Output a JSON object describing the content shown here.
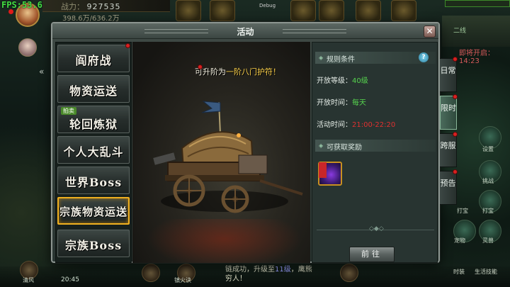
{
  "hud": {
    "fps": "FPS:53.69",
    "power_label": "战力：",
    "power_value": "927535",
    "gold": "398.6万/636.2万",
    "debug": "Debug",
    "minimap_label": "二线",
    "timer": "即将开启：14:23",
    "chat_line1_a": "链成功，升级至",
    "chat_line1_b": "11级",
    "chat_line1_c": "，鹰熊",
    "chat_line2": "穷人！",
    "bottom_time": "20:45",
    "bottom_label_a": "清风",
    "bottom_label_b": "镇火诀",
    "right_labels": [
      "设置",
      "挑战",
      "打宝",
      "打宝",
      "宠物",
      "灵兽",
      "时装",
      "生活技能"
    ]
  },
  "dialog": {
    "title": "活动",
    "close": "✕",
    "menu": [
      {
        "label": "阎府战",
        "tag": "",
        "active": false
      },
      {
        "label": "物资运送",
        "tag": "",
        "active": false
      },
      {
        "label": "轮回炼狱",
        "tag": "拍卖",
        "active": false
      },
      {
        "label": "个人大乱斗",
        "tag": "",
        "active": false
      },
      {
        "label": "世界Boss",
        "tag": "",
        "active": false
      },
      {
        "label": "宗族物资运送",
        "tag": "",
        "active": true
      },
      {
        "label": "宗族Boss",
        "tag": "",
        "active": false
      }
    ],
    "art_caption_prefix": "可升阶为",
    "art_caption_highlight": "一阶八门护符！",
    "rules": {
      "header": "规则条件",
      "help": "?",
      "level_label": "开放等级：",
      "level_value": "40级",
      "time_label": "开放时间：",
      "time_value": "每天",
      "activity_label": "活动时间：",
      "activity_value": "21:00-22:20"
    },
    "rewards": {
      "header": "可获取奖励"
    },
    "goto_button": "前往"
  },
  "side_tabs": [
    {
      "label": "日常",
      "active": false
    },
    {
      "label": "限时",
      "active": true
    },
    {
      "label": "跨服",
      "active": false
    },
    {
      "label": "预告",
      "active": false
    }
  ],
  "colors": {
    "accent_gold": "#f0b020",
    "value_green": "#56d44e",
    "value_red": "#e03030",
    "fps_green": "#43e043"
  }
}
